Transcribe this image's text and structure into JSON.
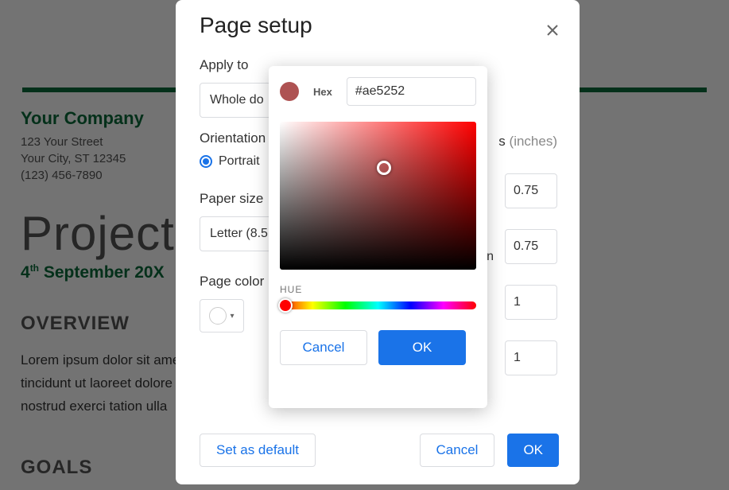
{
  "doc": {
    "company_name": "Your Company",
    "addr_line1": "123 Your Street",
    "addr_line2": "Your City, ST 12345",
    "phone": "(123) 456-7890",
    "project_title": "Project",
    "date_line_pre": "4",
    "date_line_sup": "th",
    "date_line_post": " September 20X",
    "overview_h": "OVERVIEW",
    "body": "Lorem ipsum dolor sit amet, consectetuer adipiscing elit, sed diam nonummy nibh euismod tincidunt ut laoreet dolore magna aliquam erat volutpat. Ut wisi enim ad minim veniam, quis nostrud exerci tation ulla",
    "goals_h": "GOALS"
  },
  "dialog": {
    "title": "Page setup",
    "apply_to_label": "Apply to",
    "apply_to_value": "Whole do",
    "orientation_label": "Orientation",
    "portrait_label": "Portrait",
    "paper_size_label": "Paper size",
    "paper_size_value": "Letter (8.5",
    "page_color_label": "Page color",
    "margins_label": "s",
    "inches_label": "(inches)",
    "row2_label": "n",
    "margins": {
      "top": "0.75",
      "bottom": "0.75",
      "left": "1",
      "right": "1"
    },
    "set_default": "Set as default",
    "cancel": "Cancel",
    "ok": "OK"
  },
  "picker": {
    "current_hex": "#ae5252",
    "hex_label": "Hex",
    "hex_value": "#ae5252",
    "hue_label": "HUE",
    "cancel": "Cancel",
    "ok": "OK"
  }
}
